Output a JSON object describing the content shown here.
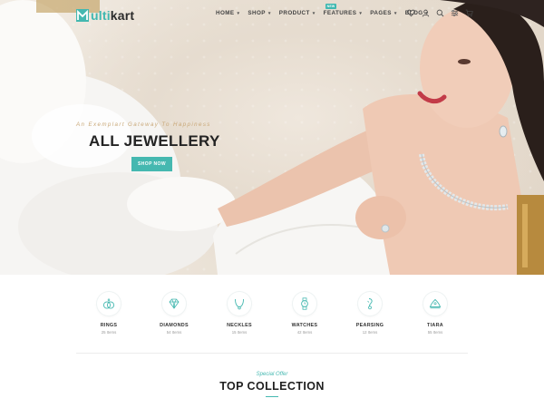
{
  "brand": {
    "logo_prefix": "M",
    "logo_accent_letters": "ulti",
    "logo_rest": "kart"
  },
  "nav": {
    "items": [
      {
        "label": "HOME"
      },
      {
        "label": "SHOP"
      },
      {
        "label": "PRODUCT"
      },
      {
        "label": "FEATURES",
        "badge": "NEW"
      },
      {
        "label": "PAGES"
      },
      {
        "label": "BLOG"
      }
    ],
    "icons": [
      "heart-icon",
      "user-icon",
      "search-icon",
      "settings-icon",
      "cart-icon"
    ]
  },
  "hero": {
    "subtitle": "An Exemplart Gateway To Happiness",
    "title": "ALL JEWELLERY",
    "button": "SHOP NOW"
  },
  "categories": [
    {
      "name": "RINGS",
      "count": "25 Items",
      "icon": "ring-icon"
    },
    {
      "name": "DIAMONDS",
      "count": "54 Items",
      "icon": "diamond-icon"
    },
    {
      "name": "NECKLES",
      "count": "15 Items",
      "icon": "necklace-icon"
    },
    {
      "name": "WATCHES",
      "count": "42 Items",
      "icon": "watch-icon"
    },
    {
      "name": "PEARSING",
      "count": "12 Items",
      "icon": "earring-icon"
    },
    {
      "name": "TIARA",
      "count": "55 Items",
      "icon": "tiara-icon"
    }
  ],
  "section": {
    "offer": "Special Offer",
    "title": "TOP COLLECTION"
  },
  "colors": {
    "accent": "#45b8b0",
    "text": "#232323",
    "gold": "#c9a878"
  }
}
